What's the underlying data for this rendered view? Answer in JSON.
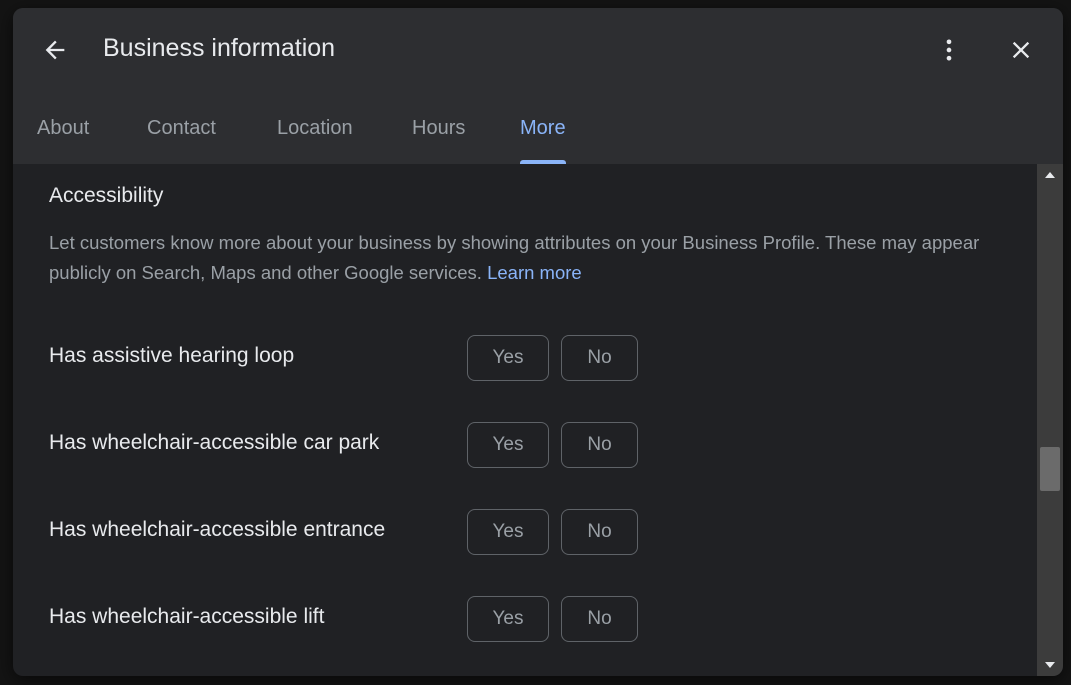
{
  "dialog": {
    "title": "Business information"
  },
  "icons": {
    "back": "arrow-back-icon",
    "more": "more-vert-icon",
    "close": "close-icon",
    "scroll_up": "triangle-up-icon",
    "scroll_down": "triangle-down-icon"
  },
  "tabs": [
    {
      "label": "About",
      "active": false
    },
    {
      "label": "Contact",
      "active": false
    },
    {
      "label": "Location",
      "active": false
    },
    {
      "label": "Hours",
      "active": false
    },
    {
      "label": "More",
      "active": true
    }
  ],
  "section": {
    "title": "Accessibility",
    "description": "Let customers know more about your business by showing attributes on your Business Profile. These may appear publicly on Search, Maps and other Google services.",
    "learn_more": "Learn more"
  },
  "attributes": [
    {
      "label": "Has assistive hearing loop",
      "yes": "Yes",
      "no": "No"
    },
    {
      "label": "Has wheelchair-accessible car park",
      "yes": "Yes",
      "no": "No"
    },
    {
      "label": "Has wheelchair-accessible entrance",
      "yes": "Yes",
      "no": "No"
    },
    {
      "label": "Has wheelchair-accessible lift",
      "yes": "Yes",
      "no": "No"
    }
  ],
  "colors": {
    "accent": "#8ab4f8",
    "dialog_bg": "#202124",
    "header_bg": "#2d2e31",
    "text_primary": "#e8eaed",
    "text_secondary": "#9aa0a6"
  }
}
